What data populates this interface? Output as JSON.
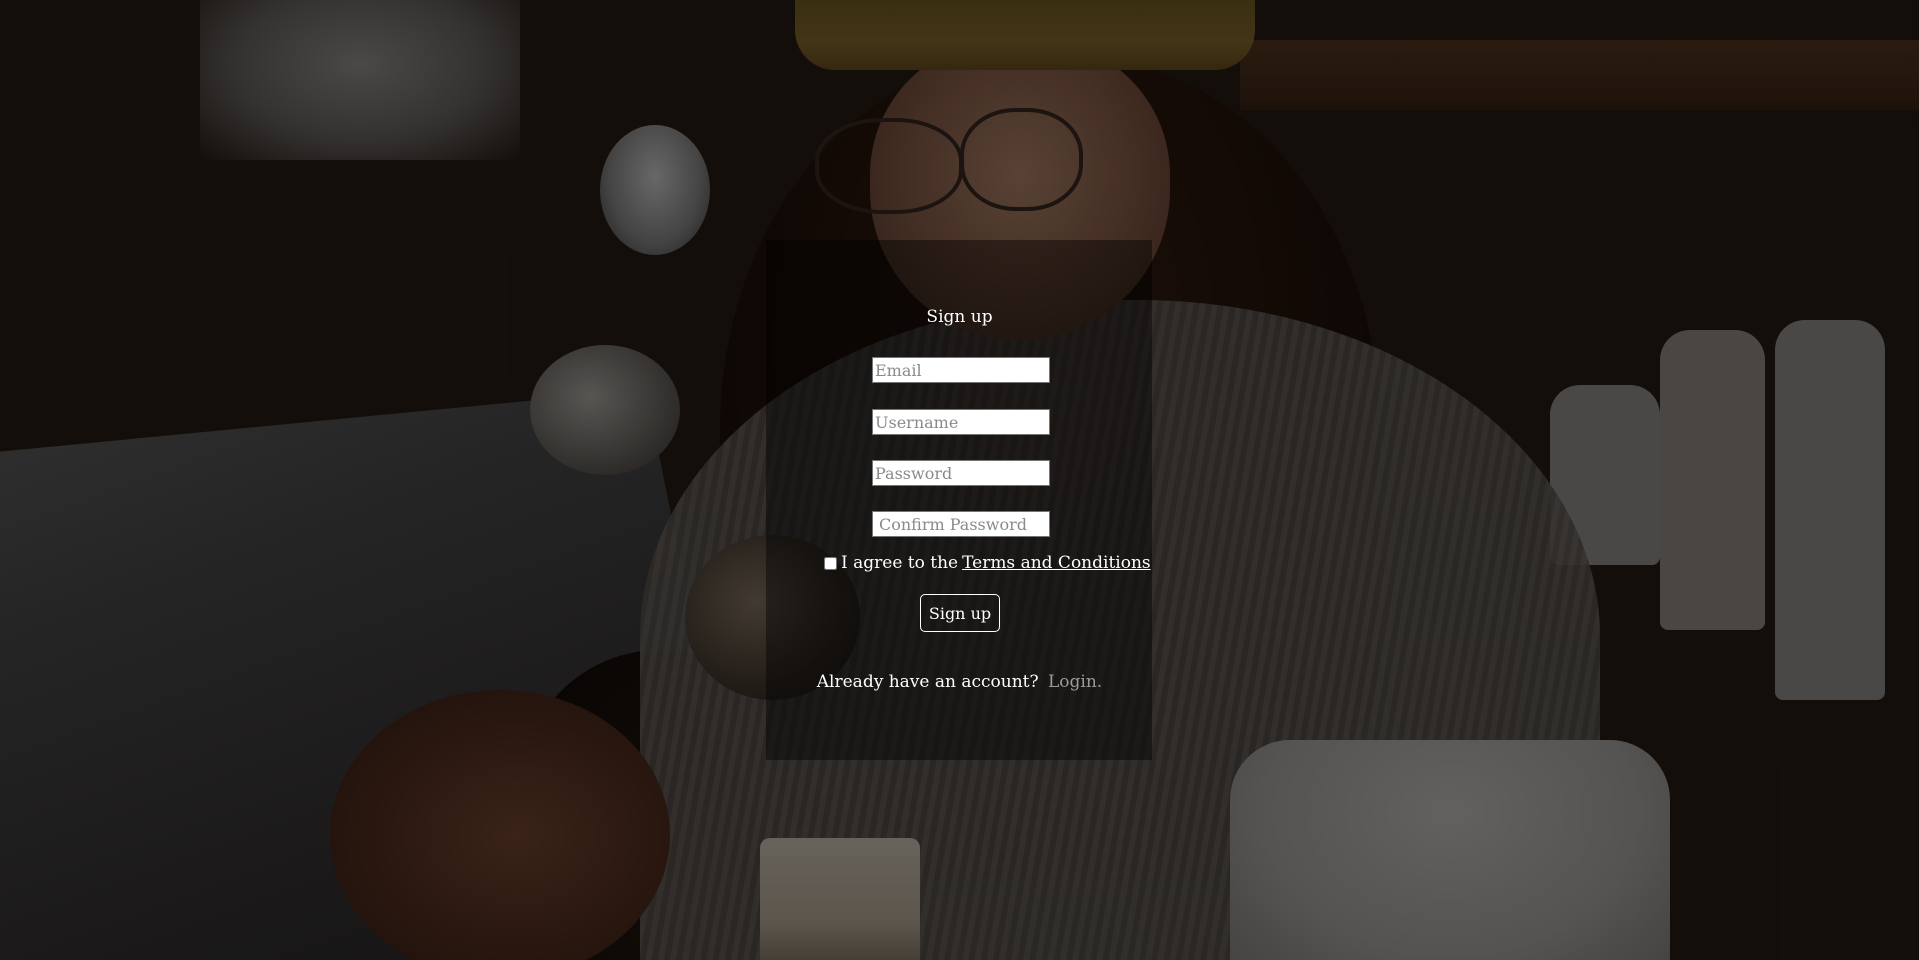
{
  "form": {
    "title": "Sign up",
    "email_placeholder": "Email",
    "username_placeholder": "Username",
    "password_placeholder": "Password",
    "confirm_placeholder": "Confirm Password",
    "terms_prefix": "I agree to the",
    "terms_link": "Terms and Conditions",
    "terms_checked": false,
    "submit_label": "Sign up",
    "footer_text": "Already have an account?",
    "login_link": "Login."
  },
  "colors": {
    "text": "#ffffff",
    "link_muted": "#9b9b9b",
    "overlay": "rgba(0,0,0,0.52)"
  },
  "background": {
    "icon": "cafe-photo-background"
  }
}
